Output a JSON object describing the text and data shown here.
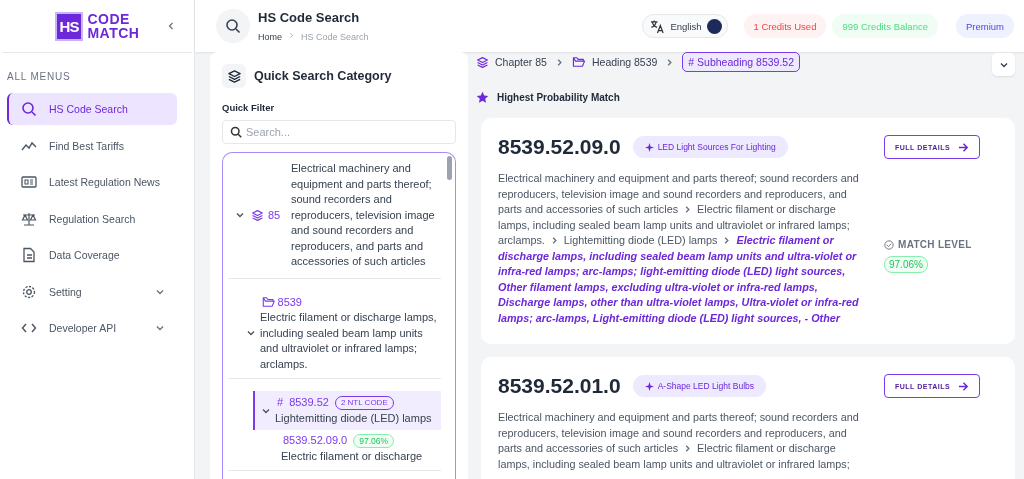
{
  "sidebar": {
    "logo": {
      "badge": "HS",
      "line_1": "CODE",
      "line_2": "MATCH"
    },
    "section_label": "ALL MENUS",
    "items": [
      {
        "label": "HS Code Search",
        "kind": "search",
        "selected": true,
        "expandable": false
      },
      {
        "label": "Find Best Tariffs",
        "kind": "trend",
        "selected": false,
        "expandable": false
      },
      {
        "label": "Latest Regulation News",
        "kind": "news",
        "selected": false,
        "expandable": false
      },
      {
        "label": "Regulation Search",
        "kind": "scale",
        "selected": false,
        "expandable": false
      },
      {
        "label": "Data Coverage",
        "kind": "document",
        "selected": false,
        "expandable": false
      },
      {
        "label": "Setting",
        "kind": "gear",
        "selected": false,
        "expandable": true
      },
      {
        "label": "Developer API",
        "kind": "code",
        "selected": false,
        "expandable": true
      }
    ]
  },
  "header": {
    "title": "HS Code Search",
    "breadcrumb": [
      "Home",
      "HS Code Search"
    ],
    "language": "English",
    "credits_used": "1 Credits Used",
    "credits_balance": "999 Credits Balance",
    "plan": "Premium"
  },
  "quick_search": {
    "title": "Quick Search Category",
    "filter_label": "Quick Filter",
    "search": {
      "placeholder": "Search..."
    },
    "tree": [
      {
        "kind": "chapter",
        "code": "85",
        "description": "Electrical machinery and equipment and parts thereof; sound recorders and reproducers, television image and sound recorders and reproducers, and parts and accessories of such articles",
        "expanded": true,
        "children": [
          {
            "kind": "heading",
            "code": "8539",
            "description": "Electric filament or discharge lamps, including sealed beam lamp units and ultraviolet or infrared lamps; arclamps.",
            "expanded": true,
            "children": [
              {
                "kind": "subheading",
                "marker": "#",
                "code": "8539.52",
                "badge": "2 NTL CODE",
                "description": "Lightemitting diode (LED) lamps",
                "expanded": true,
                "selected": true,
                "children": [
                  {
                    "kind": "code",
                    "code": "8539.52.09.0",
                    "match": "97.06%",
                    "description": "Electric filament or discharge"
                  }
                ]
              }
            ]
          }
        ]
      }
    ]
  },
  "path": [
    {
      "kind": "chapter",
      "label": "Chapter 85",
      "selected": false
    },
    {
      "kind": "heading",
      "label": "Heading 8539",
      "selected": false
    },
    {
      "kind": "subheading",
      "label": "# Subheading 8539.52",
      "selected": true
    }
  ],
  "results": {
    "title": "Highest Probability Match",
    "cards": [
      {
        "code": "8539.52.09.0",
        "tag": "LED Light Sources For Lighting",
        "button": "FULL DETAILS",
        "path": [
          "Electrical machinery and equipment and parts thereof; sound recorders and reproducers, television image and sound recorders and reproducers, and parts and accessories of such articles",
          "Electric filament or discharge lamps, including sealed beam lamp units and ultraviolet or infrared lamps; arclamps.",
          "Lightemitting diode (LED) lamps"
        ],
        "leaf": "Electric filament or discharge lamps, including sealed beam lamp units and ultra-violet or infra-red lamps; arc-lamps; light-emitting diode (LED) light sources, Other filament lamps, excluding ultra-violet or infra-red lamps, Discharge lamps, other than ultra-violet lamps, Ultra-violet or infra-red lamps; arc-lamps, Light-emitting diode (LED) light sources, - Other",
        "match_label": "MATCH LEVEL",
        "match": "97.06%"
      },
      {
        "code": "8539.52.01.0",
        "tag": "A-Shape LED Light Bulbs",
        "button": "FULL DETAILS",
        "path": [
          "Electrical machinery and equipment and parts thereof; sound recorders and reproducers, television image and sound recorders and reproducers, and parts and accessories of such articles",
          "Electric filament or discharge lamps, including sealed beam lamp units and ultraviolet or infrared lamps;"
        ]
      }
    ]
  }
}
